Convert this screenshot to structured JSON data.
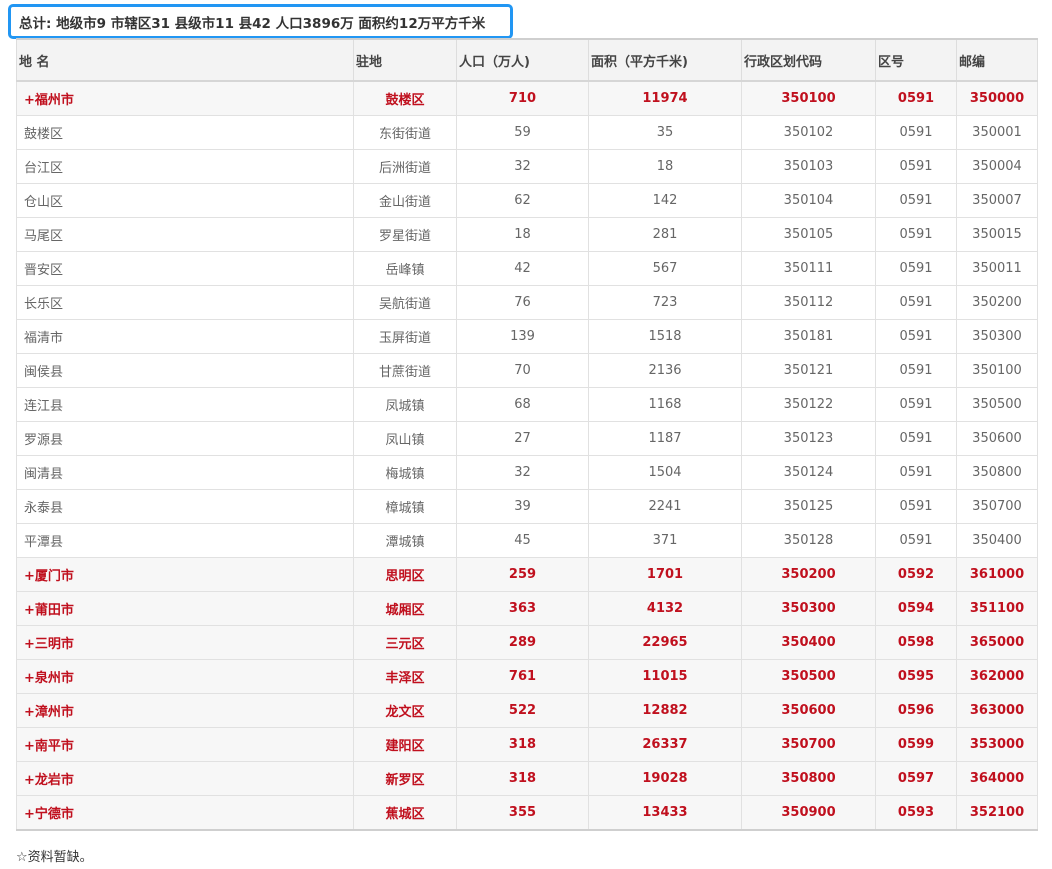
{
  "summary": "总计: 地级市9 市辖区31 县级市11 县42 人口3896万 面积约12万平方千米",
  "table": {
    "headers": [
      "地 名",
      "驻地",
      "人口（万人)",
      "面积（平方千米)",
      "行政区划代码",
      "区号",
      "邮编"
    ],
    "rows": [
      {
        "type": "city",
        "cells": [
          "+福州市",
          "鼓楼区",
          "710",
          "11974",
          "350100",
          "0591",
          "350000"
        ]
      },
      {
        "type": "county",
        "cells": [
          "鼓楼区",
          "东街街道",
          "59",
          "35",
          "350102",
          "0591",
          "350001"
        ]
      },
      {
        "type": "county",
        "cells": [
          "台江区",
          "后洲街道",
          "32",
          "18",
          "350103",
          "0591",
          "350004"
        ]
      },
      {
        "type": "county",
        "cells": [
          "仓山区",
          "金山街道",
          "62",
          "142",
          "350104",
          "0591",
          "350007"
        ]
      },
      {
        "type": "county",
        "cells": [
          "马尾区",
          "罗星街道",
          "18",
          "281",
          "350105",
          "0591",
          "350015"
        ]
      },
      {
        "type": "county",
        "cells": [
          "晋安区",
          "岳峰镇",
          "42",
          "567",
          "350111",
          "0591",
          "350011"
        ]
      },
      {
        "type": "county",
        "cells": [
          "长乐区",
          "吴航街道",
          "76",
          "723",
          "350112",
          "0591",
          "350200"
        ]
      },
      {
        "type": "county",
        "cells": [
          "福清市",
          "玉屏街道",
          "139",
          "1518",
          "350181",
          "0591",
          "350300"
        ]
      },
      {
        "type": "county",
        "cells": [
          "闽侯县",
          "甘蔗街道",
          "70",
          "2136",
          "350121",
          "0591",
          "350100"
        ]
      },
      {
        "type": "county",
        "cells": [
          "连江县",
          "凤城镇",
          "68",
          "1168",
          "350122",
          "0591",
          "350500"
        ]
      },
      {
        "type": "county",
        "cells": [
          "罗源县",
          "凤山镇",
          "27",
          "1187",
          "350123",
          "0591",
          "350600"
        ]
      },
      {
        "type": "county",
        "cells": [
          "闽清县",
          "梅城镇",
          "32",
          "1504",
          "350124",
          "0591",
          "350800"
        ]
      },
      {
        "type": "county",
        "cells": [
          "永泰县",
          "樟城镇",
          "39",
          "2241",
          "350125",
          "0591",
          "350700"
        ]
      },
      {
        "type": "county",
        "cells": [
          "平潭县",
          "潭城镇",
          "45",
          "371",
          "350128",
          "0591",
          "350400"
        ]
      },
      {
        "type": "city",
        "cells": [
          "+厦门市",
          "思明区",
          "259",
          "1701",
          "350200",
          "0592",
          "361000"
        ]
      },
      {
        "type": "city",
        "cells": [
          "+莆田市",
          "城厢区",
          "363",
          "4132",
          "350300",
          "0594",
          "351100"
        ]
      },
      {
        "type": "city",
        "cells": [
          "+三明市",
          "三元区",
          "289",
          "22965",
          "350400",
          "0598",
          "365000"
        ]
      },
      {
        "type": "city",
        "cells": [
          "+泉州市",
          "丰泽区",
          "761",
          "11015",
          "350500",
          "0595",
          "362000"
        ]
      },
      {
        "type": "city",
        "cells": [
          "+漳州市",
          "龙文区",
          "522",
          "12882",
          "350600",
          "0596",
          "363000"
        ]
      },
      {
        "type": "city",
        "cells": [
          "+南平市",
          "建阳区",
          "318",
          "26337",
          "350700",
          "0599",
          "353000"
        ]
      },
      {
        "type": "city",
        "cells": [
          "+龙岩市",
          "新罗区",
          "318",
          "19028",
          "350800",
          "0597",
          "364000"
        ]
      },
      {
        "type": "city",
        "cells": [
          "+宁德市",
          "蕉城区",
          "355",
          "13433",
          "350900",
          "0593",
          "352100"
        ]
      }
    ]
  },
  "footnote": "☆资料暂缺。"
}
